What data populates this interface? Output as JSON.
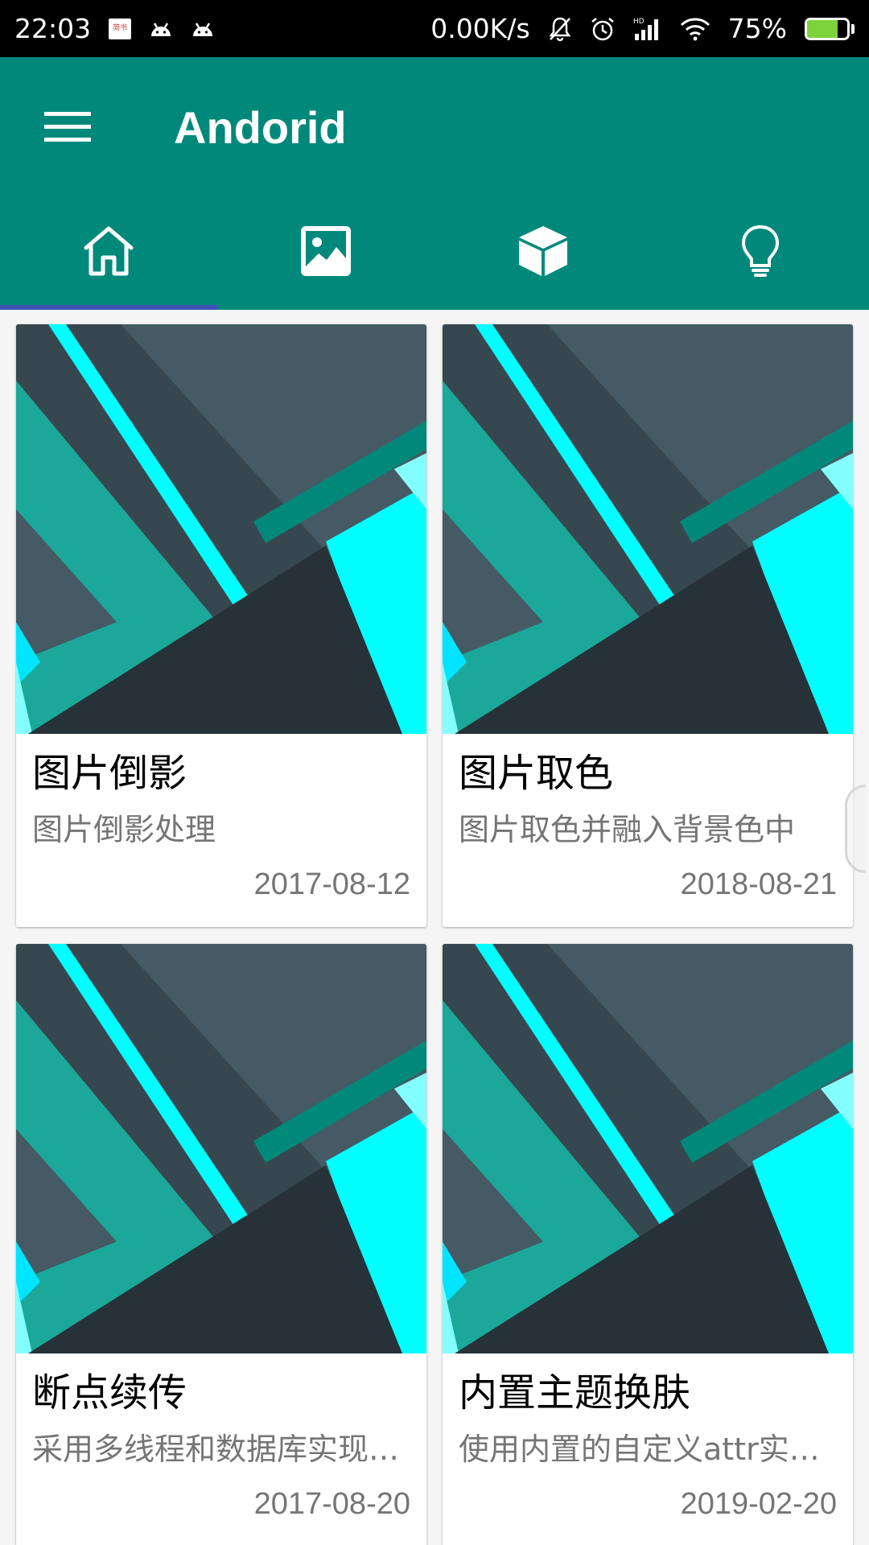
{
  "status_bar": {
    "time": "22:03",
    "notice_icon_text": "简书",
    "network_speed": "0.00K/s",
    "network_type": "HD",
    "battery_percent": "75%",
    "battery_level": 0.75,
    "icons": [
      "news-notice-icon",
      "android-icon",
      "android-icon",
      "mute-icon",
      "alarm-icon",
      "signal-icon",
      "wifi-icon",
      "battery-charging-icon"
    ]
  },
  "toolbar": {
    "title": "Andorid",
    "menu_icon": "hamburger-menu-icon",
    "background_color": "#00897b"
  },
  "tabs": [
    {
      "icon": "home-icon",
      "selected": true
    },
    {
      "icon": "image-icon",
      "selected": false
    },
    {
      "icon": "cube-icon",
      "selected": false
    },
    {
      "icon": "lightbulb-icon",
      "selected": false
    }
  ],
  "tab_indicator_color": "#3f51b5",
  "cards": [
    {
      "title": "图片倒影",
      "description": "图片倒影处理",
      "date": "2017-08-12"
    },
    {
      "title": "图片取色",
      "description": "图片取色并融入背景色中",
      "date": "2018-08-21"
    },
    {
      "title": "断点续传",
      "description": "采用多线程和数据库实现断点续传",
      "date": "2017-08-20"
    },
    {
      "title": "内置主题换肤",
      "description": "使用内置的自定义attr实现换肤",
      "date": "2019-02-20"
    }
  ]
}
